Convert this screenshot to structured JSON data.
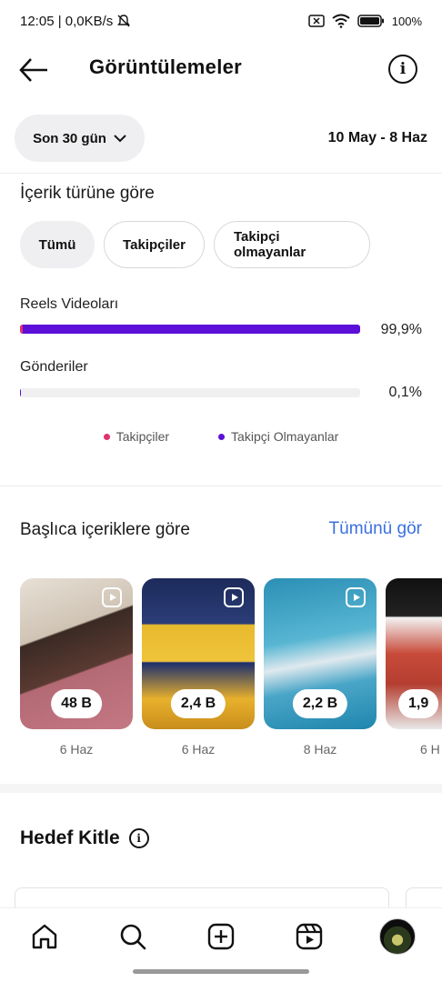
{
  "status_bar": {
    "time_and_speed": "12:05 | 0,0KB/s",
    "battery": "100%"
  },
  "header": {
    "title": "Görüntülemeler"
  },
  "filters": {
    "range_label": "Son 30 gün",
    "date_range": "10 May - 8 Haz"
  },
  "content_type": {
    "title": "İçerik türüne göre",
    "segments": [
      "Tümü",
      "Takipçiler",
      "Takipçi olmayanlar"
    ],
    "metrics": [
      {
        "label": "Reels Videoları",
        "percent_text": "99,9%",
        "fraction": 0.999
      },
      {
        "label": "Gönderiler",
        "percent_text": "0,1%",
        "fraction": 0.001
      }
    ],
    "legend": [
      {
        "label": "Takipçiler",
        "color": "#e1306c"
      },
      {
        "label": "Takipçi Olmayanlar",
        "color": "#5b0fd8"
      }
    ]
  },
  "top_content": {
    "title": "Başlıca içeriklere göre",
    "see_all": "Tümünü gör",
    "items": [
      {
        "views": "48 B",
        "date": "6 Haz"
      },
      {
        "views": "2,4 B",
        "date": "6 Haz"
      },
      {
        "views": "2,2 B",
        "date": "8 Haz"
      },
      {
        "views": "1,9",
        "date": "6 H"
      }
    ]
  },
  "audience": {
    "title": "Hedef Kitle"
  },
  "colors": {
    "accent_blue": "#3b6fe0",
    "bar_purple": "#5b0fd8",
    "follower_pink": "#e1306c"
  },
  "icons": {
    "back": "arrow-left-icon",
    "info": "info-icon",
    "nav": [
      "home-icon",
      "search-icon",
      "add-icon",
      "reels-icon",
      "profile-avatar"
    ]
  }
}
